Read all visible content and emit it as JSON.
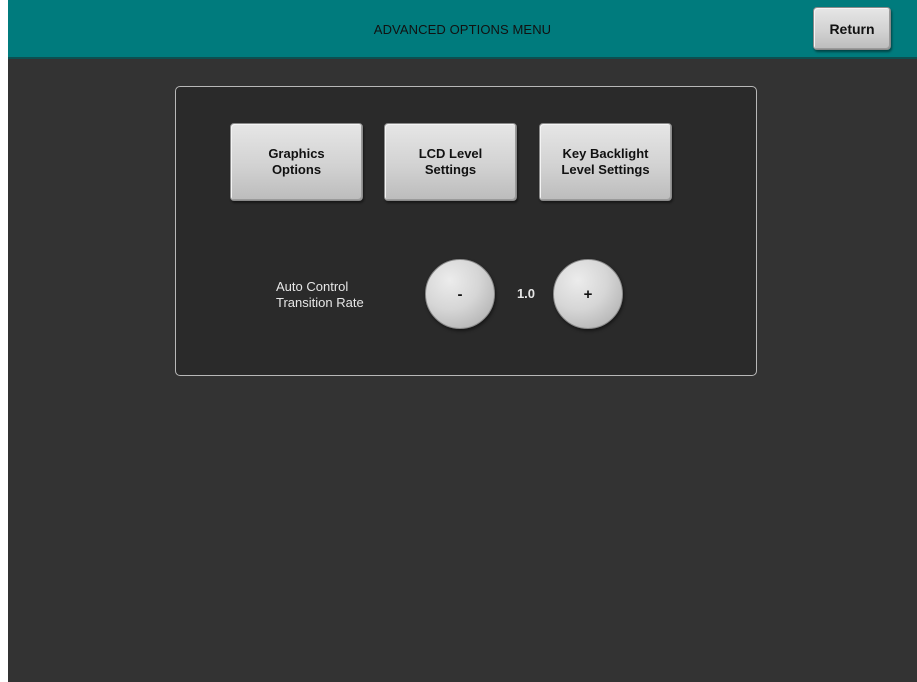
{
  "header": {
    "title": "ADVANCED OPTIONS MENU",
    "return_label": "Return"
  },
  "options": {
    "graphics_label": "Graphics\nOptions",
    "lcd_label": "LCD Level\nSettings",
    "key_backlight_label": "Key Backlight\nLevel Settings"
  },
  "transition": {
    "label": "Auto Control\nTransition Rate",
    "decrement_label": "-",
    "increment_label": "+",
    "value": "1.0"
  },
  "colors": {
    "header_bg": "#007b7d",
    "screen_bg": "#333333",
    "panel_bg": "#2a2a2a",
    "button_face": "#d2d2d2"
  }
}
